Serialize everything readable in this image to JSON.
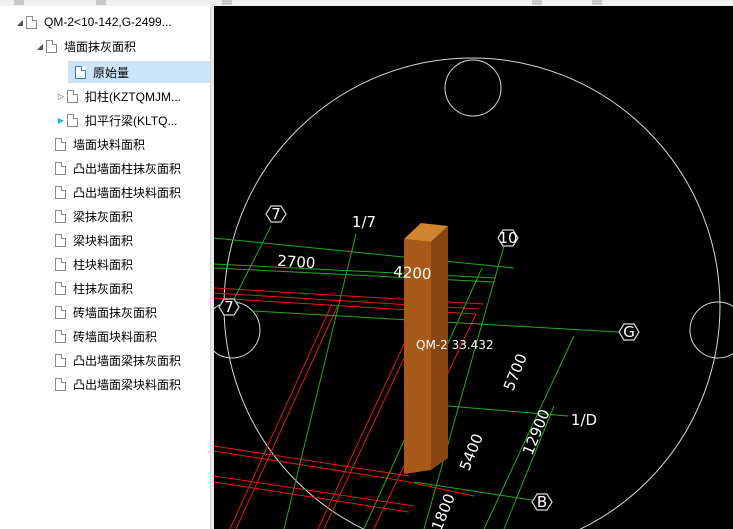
{
  "tree": {
    "items": [
      {
        "label": "QM-2<10-142,G-2499...",
        "level": 0,
        "toggle": "expanded"
      },
      {
        "label": "墙面抹灰面积",
        "level": 1,
        "toggle": "expanded"
      },
      {
        "label": "原始量",
        "level": 2,
        "toggle": "none",
        "selected": true
      },
      {
        "label": "扣柱(KZTQMJM...",
        "level": 2,
        "toggle": "collapsed"
      },
      {
        "label": "扣平行梁(KLTQ...",
        "level": 2,
        "toggle": "collapsed-cyan"
      },
      {
        "label": "墙面块料面积",
        "level": 1,
        "toggle": "none"
      },
      {
        "label": "凸出墙面柱抹灰面积",
        "level": 1,
        "toggle": "none"
      },
      {
        "label": "凸出墙面柱块料面积",
        "level": 1,
        "toggle": "none"
      },
      {
        "label": "梁抹灰面积",
        "level": 1,
        "toggle": "none"
      },
      {
        "label": "梁块料面积",
        "level": 1,
        "toggle": "none"
      },
      {
        "label": "柱块料面积",
        "level": 1,
        "toggle": "none"
      },
      {
        "label": "柱抹灰面积",
        "level": 1,
        "toggle": "none"
      },
      {
        "label": "砖墙面抹灰面积",
        "level": 1,
        "toggle": "none"
      },
      {
        "label": "砖墙面块料面积",
        "level": 1,
        "toggle": "none"
      },
      {
        "label": "凸出墙面梁抹灰面积",
        "level": 1,
        "toggle": "none"
      },
      {
        "label": "凸出墙面梁块料面积",
        "level": 1,
        "toggle": "none"
      }
    ]
  },
  "cad": {
    "axis_labels": {
      "a7_top": "7",
      "a17": "1/7",
      "a10": "10",
      "a7_left": "7",
      "aG": "G",
      "a1D": "1/D",
      "aB": "B"
    },
    "dims": {
      "d2700": "2700",
      "d4200": "4200",
      "d5700": "5700",
      "d12900": "12900",
      "d5400": "5400",
      "d1800": "1800"
    },
    "wall_label": "QM-2 33.432",
    "colors": {
      "background": "#000000",
      "grid": "#1fa81f",
      "beam": "#e01818",
      "wall": "#a85a18",
      "circle": "#d8d8d8"
    }
  }
}
